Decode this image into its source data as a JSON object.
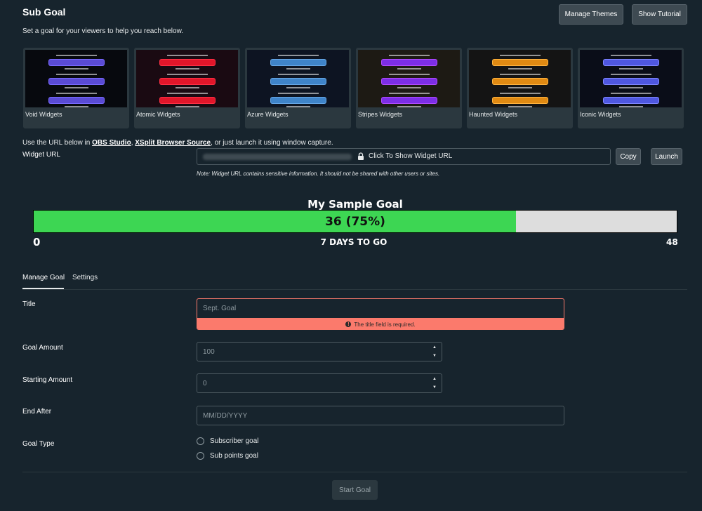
{
  "header": {
    "title": "Sub Goal",
    "subtitle": "Set a goal for your viewers to help you reach below.",
    "manage_themes": "Manage Themes",
    "show_tutorial": "Show Tutorial"
  },
  "themes": [
    {
      "label": "Void Widgets",
      "bg": "#07090e",
      "bar": "#5a4bd4",
      "accent": "#7a6bff"
    },
    {
      "label": "Atomic Widgets",
      "bg": "#1a0a12",
      "bar": "#e2162a",
      "accent": "#ff3045"
    },
    {
      "label": "Azure Widgets",
      "bg": "#0d1422",
      "bar": "#3f84c9",
      "accent": "#68a8e6"
    },
    {
      "label": "Stripes Widgets",
      "bg": "#1d1a14",
      "bar": "#7c2ee6",
      "accent": "#b24bff"
    },
    {
      "label": "Haunted Widgets",
      "bg": "#141414",
      "bar": "#e08a13",
      "accent": "#ffb440"
    },
    {
      "label": "Iconic Widgets",
      "bg": "#0a0d18",
      "bar": "#4f57e0",
      "accent": "#8087ff"
    }
  ],
  "widget_url": {
    "help_prefix": "Use the URL below in ",
    "obs": "OBS Studio",
    "sep": ", ",
    "xsplit": "XSplit Browser Source",
    "help_suffix": ", or just launch it using window capture.",
    "label": "Widget URL",
    "show_text": "Click To Show Widget URL",
    "copy": "Copy",
    "launch": "Launch",
    "note": "Note: Widget URL contains sensitive information. It should not be shared with other users or sites."
  },
  "goal_preview": {
    "name": "My Sample Goal",
    "progress_text": "36 (75%)",
    "current": 36,
    "target": 48,
    "min_label": "0",
    "max_label": "48",
    "time_left": "7 DAYS TO GO"
  },
  "tabs": {
    "manage_goal": "Manage Goal",
    "settings": "Settings"
  },
  "form": {
    "title_label": "Title",
    "title_placeholder": "Sept. Goal",
    "title_error": "The title field is required.",
    "goal_amount_label": "Goal Amount",
    "goal_amount_placeholder": "100",
    "starting_amount_label": "Starting Amount",
    "starting_amount_placeholder": "0",
    "end_after_label": "End After",
    "end_after_placeholder": "MM/DD/YYYY",
    "goal_type_label": "Goal Type",
    "goal_type_options": [
      "Subscriber goal",
      "Sub points goal"
    ],
    "start_button": "Start Goal"
  },
  "colors": {
    "background": "#17242d",
    "fill": "#3dd653",
    "error": "#fb7a6c"
  }
}
